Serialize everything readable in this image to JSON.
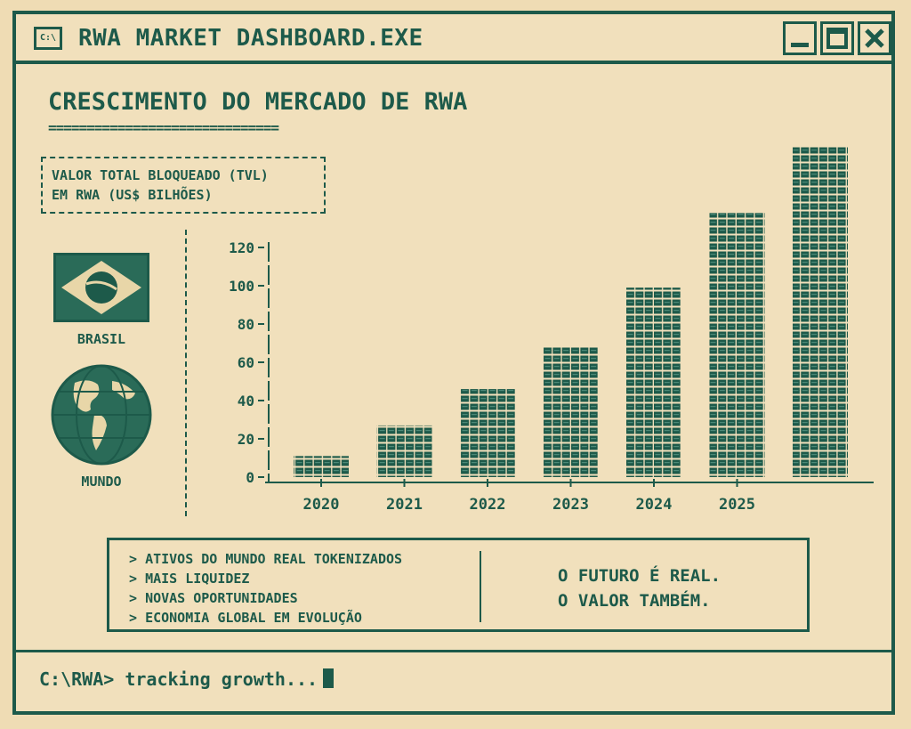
{
  "window": {
    "title": "RWA MARKET DASHBOARD.EXE",
    "icon_text": "C:\\",
    "icon": "terminal-icon",
    "controls": [
      "minimize-icon",
      "maximize-icon",
      "close-icon"
    ]
  },
  "header": {
    "title": "CRESCIMENTO DO MERCADO DE RWA",
    "rule": "=============================="
  },
  "legend": {
    "line1": "VALOR TOTAL BLOQUEADO (TVL)",
    "line2": "EM RWA (US$ BILHÕES)"
  },
  "side": {
    "flag_label": "BRASIL",
    "globe_label": "MUNDO"
  },
  "chart_data": {
    "type": "bar",
    "categories": [
      "2020",
      "2021",
      "2022",
      "2023",
      "2024",
      "2025",
      ""
    ],
    "values": [
      11,
      27,
      46,
      68,
      99,
      138,
      173
    ],
    "yticks": [
      0,
      20,
      40,
      60,
      80,
      100,
      120
    ],
    "ylim": [
      0,
      120
    ],
    "xlabel": "",
    "ylabel": "",
    "grid": false
  },
  "info": {
    "bullets": [
      "ATIVOS DO MUNDO REAL TOKENIZADOS",
      "MAIS LIQUIDEZ",
      "NOVAS OPORTUNIDADES",
      "ECONOMIA GLOBAL EM EVOLUÇÃO"
    ],
    "bullet_marker": ">",
    "slogan_line1": "O FUTURO É REAL.",
    "slogan_line2": "O VALOR TAMBÉM."
  },
  "terminal": {
    "prompt": "C:\\RWA> tracking growth..."
  },
  "colors": {
    "ink": "#1d5a4a",
    "paper": "#efdcb4",
    "flag_diamond": "#e8d6a8"
  }
}
